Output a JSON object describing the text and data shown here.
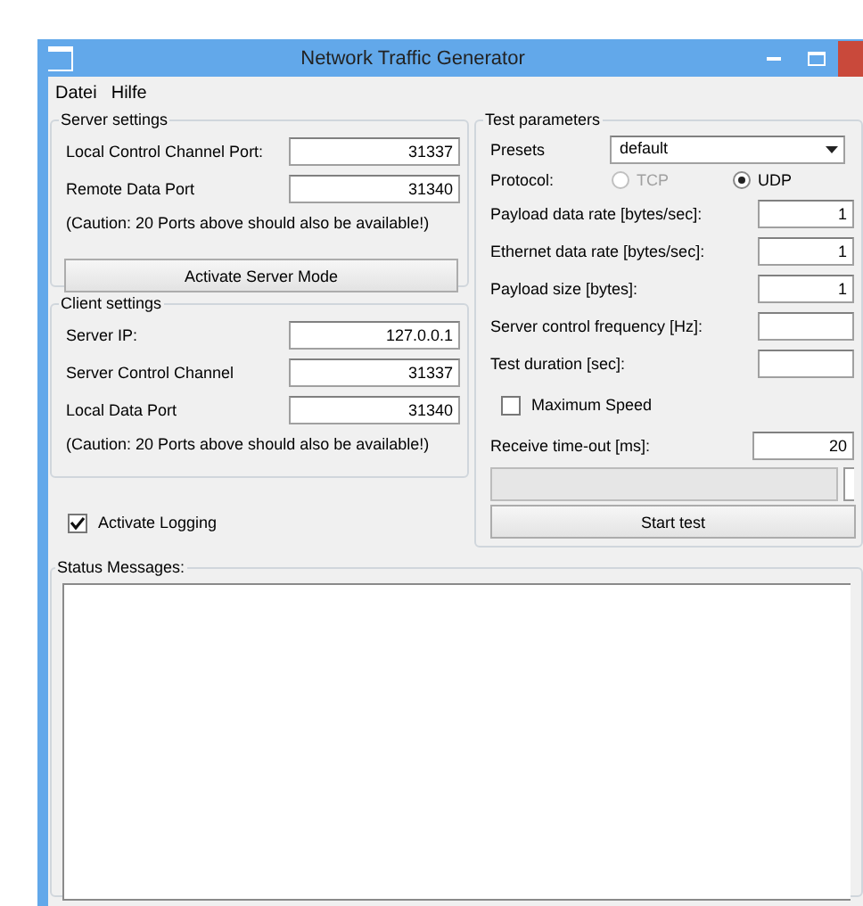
{
  "window": {
    "title": "Network Traffic Generator"
  },
  "menu": [
    {
      "label": "Datei"
    },
    {
      "label": "Hilfe"
    }
  ],
  "server_settings": {
    "title": "Server settings",
    "fields": [
      {
        "label": "Local Control Channel Port:",
        "value": "31337"
      },
      {
        "label": "Remote Data Port",
        "value": "31340"
      }
    ],
    "note": "(Caution: 20 Ports above should also be available!)",
    "button": "Activate Server Mode"
  },
  "client_settings": {
    "title": "Client settings",
    "fields": [
      {
        "label": "Server IP:",
        "value": "127.0.0.1"
      },
      {
        "label": "Server Control Channel",
        "value": "31337"
      },
      {
        "label": "Local Data Port",
        "value": "31340"
      }
    ],
    "note": "(Caution: 20 Ports above should also be available!)"
  },
  "logging": {
    "label": "Activate Logging",
    "checked": true
  },
  "test_parameters": {
    "title": "Test parameters",
    "presets": {
      "label": "Presets",
      "value": "default"
    },
    "protocol": {
      "label": "Protocol:",
      "options": [
        {
          "label": "TCP",
          "selected": false,
          "disabled": true
        },
        {
          "label": "UDP",
          "selected": true,
          "disabled": false
        }
      ]
    },
    "fields": [
      {
        "label": "Payload data rate [bytes/sec]:",
        "value": "1"
      },
      {
        "label": "Ethernet data rate [bytes/sec]:",
        "value": "1"
      },
      {
        "label": "Payload size [bytes]:",
        "value": "1"
      },
      {
        "label": "Server control frequency [Hz]:"
      },
      {
        "label": "Test duration [sec]:"
      }
    ],
    "maximum_speed": {
      "label": "Maximum Speed",
      "checked": false
    },
    "receive_timeout": {
      "label": "Receive time-out [ms]:",
      "value": "20"
    },
    "progress": {
      "level": 0
    },
    "button": "Start test"
  },
  "status_messages": {
    "title": "Status Messages:"
  }
}
